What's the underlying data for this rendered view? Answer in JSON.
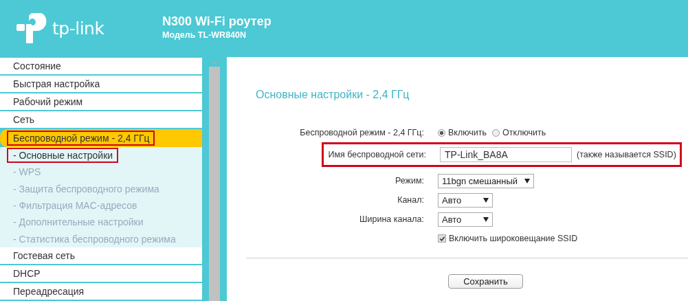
{
  "header": {
    "logo_text": "tp-link",
    "title": "N300 Wi-Fi роутер",
    "model": "Модель TL-WR840N"
  },
  "sidebar": {
    "items": [
      {
        "label": "Состояние",
        "kind": "top",
        "selected": false,
        "highlighted": false
      },
      {
        "label": "Быстрая настройка",
        "kind": "top",
        "selected": false,
        "highlighted": false
      },
      {
        "label": "Рабочий режим",
        "kind": "top",
        "selected": false,
        "highlighted": false
      },
      {
        "label": "Сеть",
        "kind": "top",
        "selected": false,
        "highlighted": false
      },
      {
        "label": "Беспроводной режим - 2,4 ГГц",
        "kind": "top",
        "selected": true,
        "highlighted": true
      },
      {
        "label": "- Основные настройки",
        "kind": "sub",
        "selected": true,
        "highlighted": true
      },
      {
        "label": "- WPS",
        "kind": "sub",
        "selected": false,
        "highlighted": false
      },
      {
        "label": "- Защита беспроводного режима",
        "kind": "sub",
        "selected": false,
        "highlighted": false
      },
      {
        "label": "- Фильтрация MAC-адресов",
        "kind": "sub",
        "selected": false,
        "highlighted": false
      },
      {
        "label": "- Дополнительные настройки",
        "kind": "sub",
        "selected": false,
        "highlighted": false
      },
      {
        "label": "- Статистика беспроводного режима",
        "kind": "sub",
        "selected": false,
        "highlighted": false
      },
      {
        "label": "Гостевая сеть",
        "kind": "top",
        "selected": false,
        "highlighted": false
      },
      {
        "label": "DHCP",
        "kind": "top",
        "selected": false,
        "highlighted": false
      },
      {
        "label": "Переадресация",
        "kind": "top",
        "selected": false,
        "highlighted": false
      }
    ]
  },
  "content": {
    "heading": "Основные настройки - 2,4 ГГц",
    "rows": [
      {
        "kind": "radio",
        "label": "Беспроводной режим - 2,4 ГГц:",
        "highlighted": false,
        "options": [
          {
            "label": "Включить",
            "selected": true
          },
          {
            "label": "Отключить",
            "selected": false
          }
        ]
      },
      {
        "kind": "text",
        "label": "Имя беспроводной сети:",
        "highlighted": true,
        "value": "TP-Link_BA8A",
        "note": "(также называется SSID)"
      },
      {
        "kind": "select",
        "label": "Режим:",
        "highlighted": false,
        "value": "11bgn смешанный",
        "wide": true
      },
      {
        "kind": "select",
        "label": "Канал:",
        "highlighted": false,
        "value": "Авто",
        "wide": false
      },
      {
        "kind": "select",
        "label": "Ширина канала:",
        "highlighted": false,
        "value": "Авто",
        "wide": false
      },
      {
        "kind": "checkbox",
        "label": "Включить широковещание SSID",
        "highlighted": false,
        "checked": true
      }
    ],
    "save_button": "Сохранить"
  }
}
